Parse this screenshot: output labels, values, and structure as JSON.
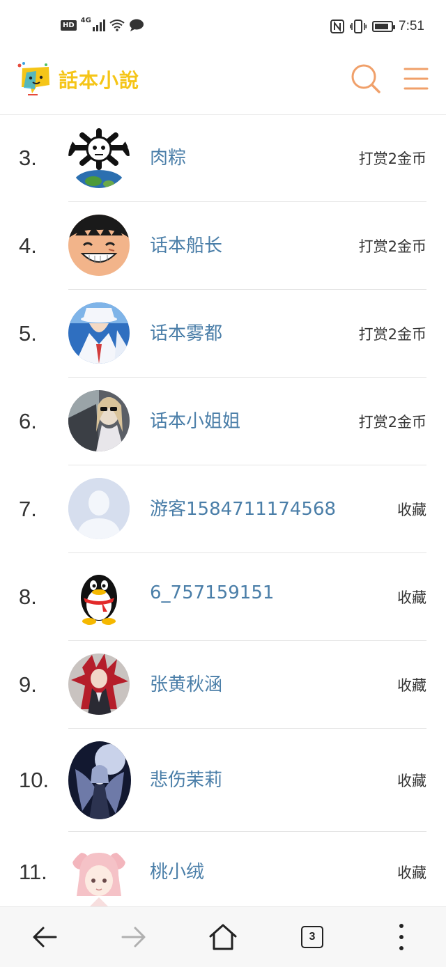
{
  "status_bar": {
    "left_badge": "HD",
    "network": "4G",
    "time": "7:51",
    "battery_level": 0.75
  },
  "header": {
    "logo_text": "話本小說",
    "accent_color": "#f0a06a"
  },
  "leaderboard": [
    {
      "rank": "3.",
      "name": "肉粽",
      "action": "打赏2金币"
    },
    {
      "rank": "4.",
      "name": "话本船长",
      "action": "打赏2金币"
    },
    {
      "rank": "5.",
      "name": "话本雾都",
      "action": "打赏2金币"
    },
    {
      "rank": "6.",
      "name": "话本小姐姐",
      "action": "打赏2金币"
    },
    {
      "rank": "7.",
      "name": "游客1584711174568",
      "action": "收藏"
    },
    {
      "rank": "8.",
      "name": "6_757159151",
      "action": "收藏"
    },
    {
      "rank": "9.",
      "name": "张黄秋涵",
      "action": "收藏"
    },
    {
      "rank": "10.",
      "name": "悲伤茉莉",
      "action": "收藏"
    },
    {
      "rank": "11.",
      "name": "桃小绒",
      "action": "收藏"
    }
  ],
  "bottom_nav": {
    "tab_count": "3"
  }
}
